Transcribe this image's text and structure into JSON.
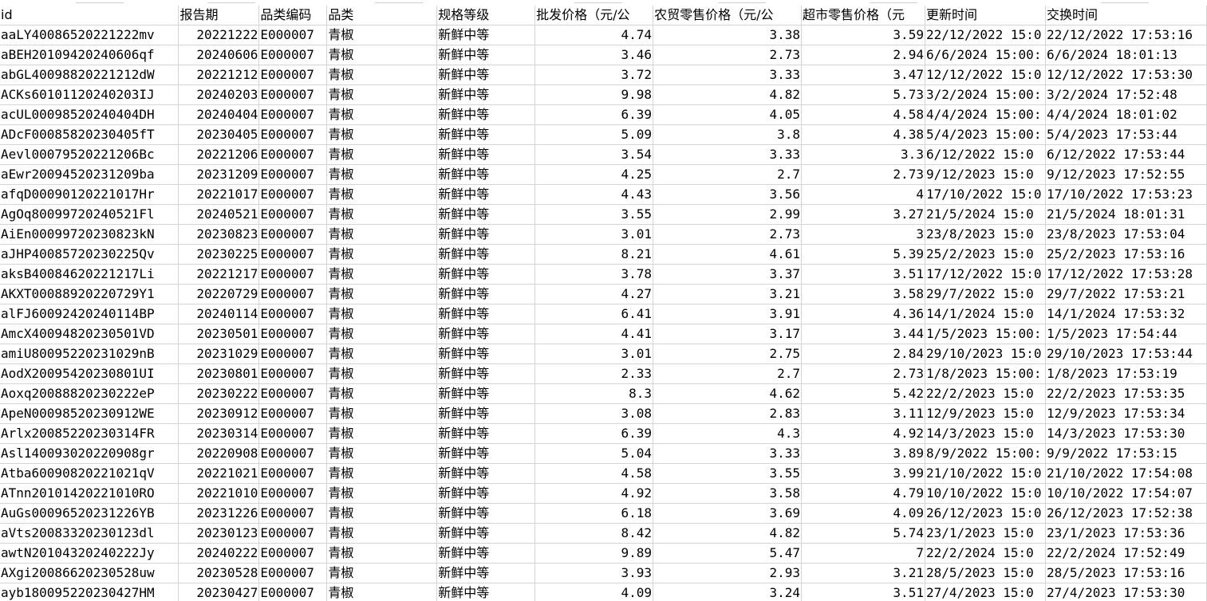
{
  "sheet": {
    "headers": [
      "id",
      "报告期",
      "品类编码",
      "品类",
      "规格等级",
      "批发价格（元/公",
      "农贸零售价格（元/公",
      "超市零售价格（元",
      "更新时间",
      "交换时间"
    ],
    "rows": [
      [
        "aaLY40086520221222mv",
        "20221222",
        "E000007",
        "青椒",
        "新鲜中等",
        "4.74",
        "3.38",
        "3.59",
        "22/12/2022 15:0",
        "22/12/2022 17:53:16"
      ],
      [
        "aBEH20109420240606qf",
        "20240606",
        "E000007",
        "青椒",
        "新鲜中等",
        "3.46",
        "2.73",
        "2.94",
        "6/6/2024 15:00:",
        "6/6/2024 18:01:13"
      ],
      [
        "abGL40098820221212dW",
        "20221212",
        "E000007",
        "青椒",
        "新鲜中等",
        "3.72",
        "3.33",
        "3.47",
        "12/12/2022 15:0",
        "12/12/2022 17:53:30"
      ],
      [
        "ACKs60101120240203IJ",
        "20240203",
        "E000007",
        "青椒",
        "新鲜中等",
        "9.98",
        "4.82",
        "5.73",
        "3/2/2024 15:00:",
        "3/2/2024 17:52:48"
      ],
      [
        "acUL00098520240404DH",
        "20240404",
        "E000007",
        "青椒",
        "新鲜中等",
        "6.39",
        "4.05",
        "4.58",
        "4/4/2024 15:00:",
        "4/4/2024 18:01:02"
      ],
      [
        "ADcF00085820230405fT",
        "20230405",
        "E000007",
        "青椒",
        "新鲜中等",
        "5.09",
        "3.8",
        "4.38",
        "5/4/2023 15:00:",
        "5/4/2023 17:53:44"
      ],
      [
        "Aevl00079520221206Bc",
        "20221206",
        "E000007",
        "青椒",
        "新鲜中等",
        "3.54",
        "3.33",
        "3.3",
        "6/12/2022 15:0",
        "6/12/2022 17:53:44"
      ],
      [
        "aEwr20094520231209ba",
        "20231209",
        "E000007",
        "青椒",
        "新鲜中等",
        "4.25",
        "2.7",
        "2.73",
        "9/12/2023 15:0",
        "9/12/2023 17:52:55"
      ],
      [
        "afqD00090120221017Hr",
        "20221017",
        "E000007",
        "青椒",
        "新鲜中等",
        "4.43",
        "3.56",
        "4",
        "17/10/2022 15:0",
        "17/10/2022 17:53:23"
      ],
      [
        "AgOq80099720240521Fl",
        "20240521",
        "E000007",
        "青椒",
        "新鲜中等",
        "3.55",
        "2.99",
        "3.27",
        "21/5/2024 15:0",
        "21/5/2024 18:01:31"
      ],
      [
        "AiEn00099720230823kN",
        "20230823",
        "E000007",
        "青椒",
        "新鲜中等",
        "3.01",
        "2.73",
        "3",
        "23/8/2023 15:0",
        "23/8/2023 17:53:04"
      ],
      [
        "aJHP40085720230225Qv",
        "20230225",
        "E000007",
        "青椒",
        "新鲜中等",
        "8.21",
        "4.61",
        "5.39",
        "25/2/2023 15:0",
        "25/2/2023 17:53:16"
      ],
      [
        "aksB40084620221217Li",
        "20221217",
        "E000007",
        "青椒",
        "新鲜中等",
        "3.78",
        "3.37",
        "3.51",
        "17/12/2022 15:0",
        "17/12/2022 17:53:28"
      ],
      [
        "AKXT00088920220729Y1",
        "20220729",
        "E000007",
        "青椒",
        "新鲜中等",
        "4.27",
        "3.21",
        "3.58",
        "29/7/2022 15:0",
        "29/7/2022 17:53:21"
      ],
      [
        "alFJ60092420240114BP",
        "20240114",
        "E000007",
        "青椒",
        "新鲜中等",
        "6.41",
        "3.91",
        "4.36",
        "14/1/2024 15:0",
        "14/1/2024 17:53:32"
      ],
      [
        "AmcX40094820230501VD",
        "20230501",
        "E000007",
        "青椒",
        "新鲜中等",
        "4.41",
        "3.17",
        "3.44",
        "1/5/2023 15:00:",
        "1/5/2023 17:54:44"
      ],
      [
        "amiU80095220231029nB",
        "20231029",
        "E000007",
        "青椒",
        "新鲜中等",
        "3.01",
        "2.75",
        "2.84",
        "29/10/2023 15:0",
        "29/10/2023 17:53:44"
      ],
      [
        "AodX20095420230801UI",
        "20230801",
        "E000007",
        "青椒",
        "新鲜中等",
        "2.33",
        "2.7",
        "2.73",
        "1/8/2023 15:00:",
        "1/8/2023 17:53:19"
      ],
      [
        "Aoxq20088820230222eP",
        "20230222",
        "E000007",
        "青椒",
        "新鲜中等",
        "8.3",
        "4.62",
        "5.42",
        "22/2/2023 15:0",
        "22/2/2023 17:53:35"
      ],
      [
        "ApeN00098520230912WE",
        "20230912",
        "E000007",
        "青椒",
        "新鲜中等",
        "3.08",
        "2.83",
        "3.11",
        "12/9/2023 15:0",
        "12/9/2023 17:53:34"
      ],
      [
        "Arlx20085220230314FR",
        "20230314",
        "E000007",
        "青椒",
        "新鲜中等",
        "6.39",
        "4.3",
        "4.92",
        "14/3/2023 15:0",
        "14/3/2023 17:53:30"
      ],
      [
        "Asl140093020220908gr",
        "20220908",
        "E000007",
        "青椒",
        "新鲜中等",
        "5.04",
        "3.33",
        "3.89",
        "8/9/2022 15:00:",
        "9/9/2022 17:53:15"
      ],
      [
        "Atba60090820221021qV",
        "20221021",
        "E000007",
        "青椒",
        "新鲜中等",
        "4.58",
        "3.55",
        "3.99",
        "21/10/2022 15:0",
        "21/10/2022 17:54:08"
      ],
      [
        "ATnn20101420221010RO",
        "20221010",
        "E000007",
        "青椒",
        "新鲜中等",
        "4.92",
        "3.58",
        "4.79",
        "10/10/2022 15:0",
        "10/10/2022 17:54:07"
      ],
      [
        "AuGs00096520231226YB",
        "20231226",
        "E000007",
        "青椒",
        "新鲜中等",
        "6.18",
        "3.69",
        "4.09",
        "26/12/2023 15:0",
        "26/12/2023 17:52:38"
      ],
      [
        "aVts20083320230123dl",
        "20230123",
        "E000007",
        "青椒",
        "新鲜中等",
        "8.42",
        "4.82",
        "5.74",
        "23/1/2023 15:0",
        "23/1/2023 17:53:36"
      ],
      [
        "awtN20104320240222Jy",
        "20240222",
        "E000007",
        "青椒",
        "新鲜中等",
        "9.89",
        "5.47",
        "7",
        "22/2/2024 15:0",
        "22/2/2024 17:52:49"
      ],
      [
        "AXgi20086620230528uw",
        "20230528",
        "E000007",
        "青椒",
        "新鲜中等",
        "3.93",
        "2.93",
        "3.21",
        "28/5/2023 15:0",
        "28/5/2023 17:53:16"
      ],
      [
        "ayb180095220230427HM",
        "20230427",
        "E000007",
        "青椒",
        "新鲜中等",
        "4.09",
        "3.24",
        "3.51",
        "27/4/2023 15:0",
        "27/4/2023 17:53:30"
      ]
    ]
  }
}
